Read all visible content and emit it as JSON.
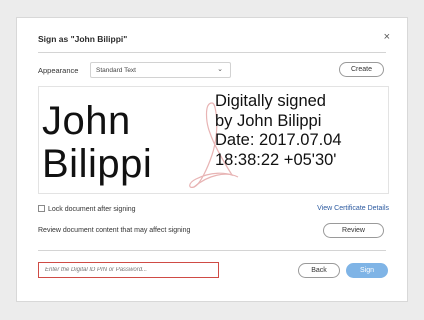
{
  "dialog": {
    "title": "Sign as \"John Bilippi\"",
    "close_glyph": "×"
  },
  "appearance": {
    "label": "Appearance",
    "selected": "Standard Text",
    "create_label": "Create"
  },
  "preview": {
    "name_first": "John",
    "name_last": "Bilippi",
    "details": [
      "Digitally signed",
      "by John Bilippi",
      "Date: 2017.07.04",
      "18:38:22 +05'30'"
    ],
    "watermark_icon": "acrobat-logo-watermark",
    "watermark_color": "#e8b4b4"
  },
  "options": {
    "lock_label": "Lock document after signing",
    "lock_checked": false,
    "view_cert_label": "View Certificate Details",
    "review_text": "Review document content that may affect signing",
    "review_label": "Review"
  },
  "footer": {
    "pin_placeholder": "Enter the Digital ID PIN or Password...",
    "back_label": "Back",
    "sign_label": "Sign"
  },
  "colors": {
    "link": "#2c5aa0",
    "primary_button": "#7fb4e6",
    "error_border": "#cf4b45"
  }
}
